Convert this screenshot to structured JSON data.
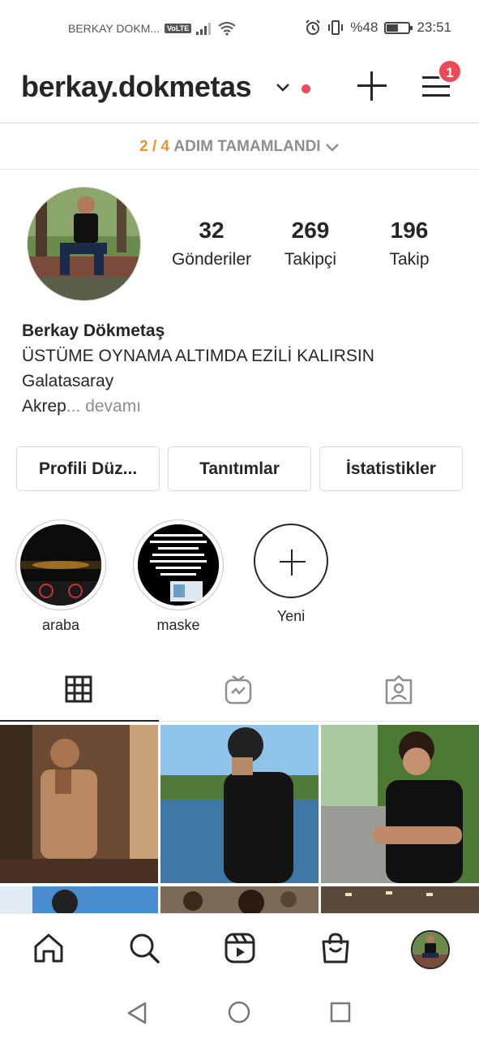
{
  "status_bar": {
    "carrier": "BERKAY DOKM...",
    "volte": "VoLTE",
    "battery": "%48",
    "battery_level": 0.48,
    "time": "23:51"
  },
  "header": {
    "username": "berkay.dokmetas",
    "menu_badge": "1"
  },
  "steps": {
    "count": "2 / 4",
    "label": "ADIM TAMAMLANDI"
  },
  "profile": {
    "stats": [
      {
        "value": "32",
        "label": "Gönderiler"
      },
      {
        "value": "269",
        "label": "Takipçi"
      },
      {
        "value": "196",
        "label": "Takip"
      }
    ],
    "name": "Berkay Dökmetaş",
    "bio_lines": [
      "ÜSTÜME OYNAMA ALTIMDA EZİLİ KALIRSIN",
      "Galatasaray"
    ],
    "bio_truncated": "Akrep",
    "more_label": "... devamı"
  },
  "buttons": {
    "edit_profile": "Profili Düz...",
    "promotions": "Tanıtımlar",
    "insights": "İstatistikler"
  },
  "highlights": [
    {
      "label": "araba"
    },
    {
      "label": "maske"
    }
  ],
  "highlight_new_label": "Yeni",
  "tabs": [
    "grid-icon",
    "igtv-icon",
    "tagged-icon"
  ],
  "bottom_nav": [
    "home-icon",
    "search-icon",
    "reels-icon",
    "shop-icon",
    "profile-avatar"
  ],
  "colors": {
    "accent_orange": "#f0922a",
    "badge_red": "#ed4956",
    "text": "#262626",
    "muted": "#8e8e8e"
  }
}
